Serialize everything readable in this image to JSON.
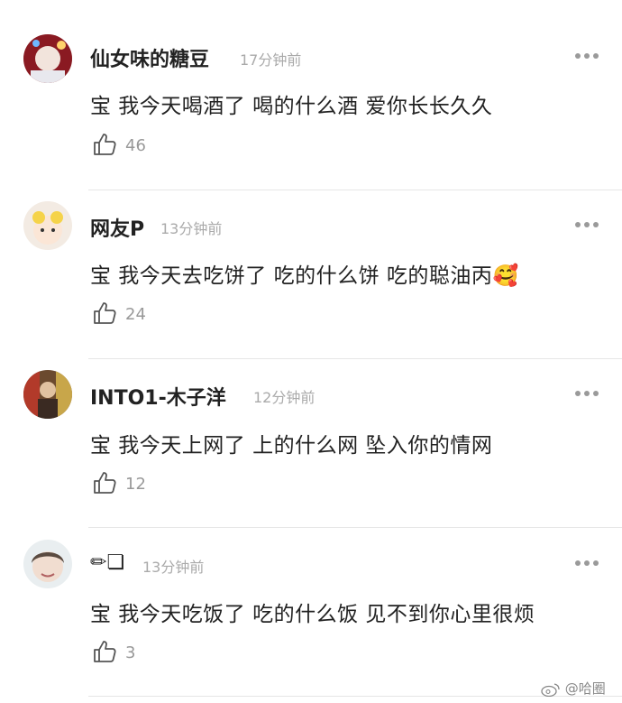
{
  "comments": [
    {
      "name": "仙女味的糖豆",
      "time": "17分钟前",
      "text": "宝 我今天喝酒了 喝的什么酒 爱你长长久久",
      "likes": "46",
      "emoji": ""
    },
    {
      "name": "网友P",
      "time": "13分钟前",
      "text": "宝 我今天去吃饼了 吃的什么饼 吃的聪油丙",
      "likes": "24",
      "emoji": "🥰"
    },
    {
      "name": "INTO1-木子洋",
      "time": "12分钟前",
      "text": "宝 我今天上网了 上的什么网 坠入你的情网",
      "likes": "12",
      "emoji": ""
    },
    {
      "name": "✏❏",
      "time": "13分钟前",
      "text": "宝 我今天吃饭了 吃的什么饭 见不到你心里很烦",
      "likes": "3",
      "emoji": ""
    }
  ],
  "watermark": "@哈圈",
  "icons": {
    "like": "thumbs-up-icon",
    "more": "more-dots-icon",
    "weibo": "weibo-logo-icon"
  },
  "colors": {
    "text": "#222222",
    "meta": "#aaaaaa",
    "count": "#999999",
    "divider": "#e6e6e6"
  }
}
